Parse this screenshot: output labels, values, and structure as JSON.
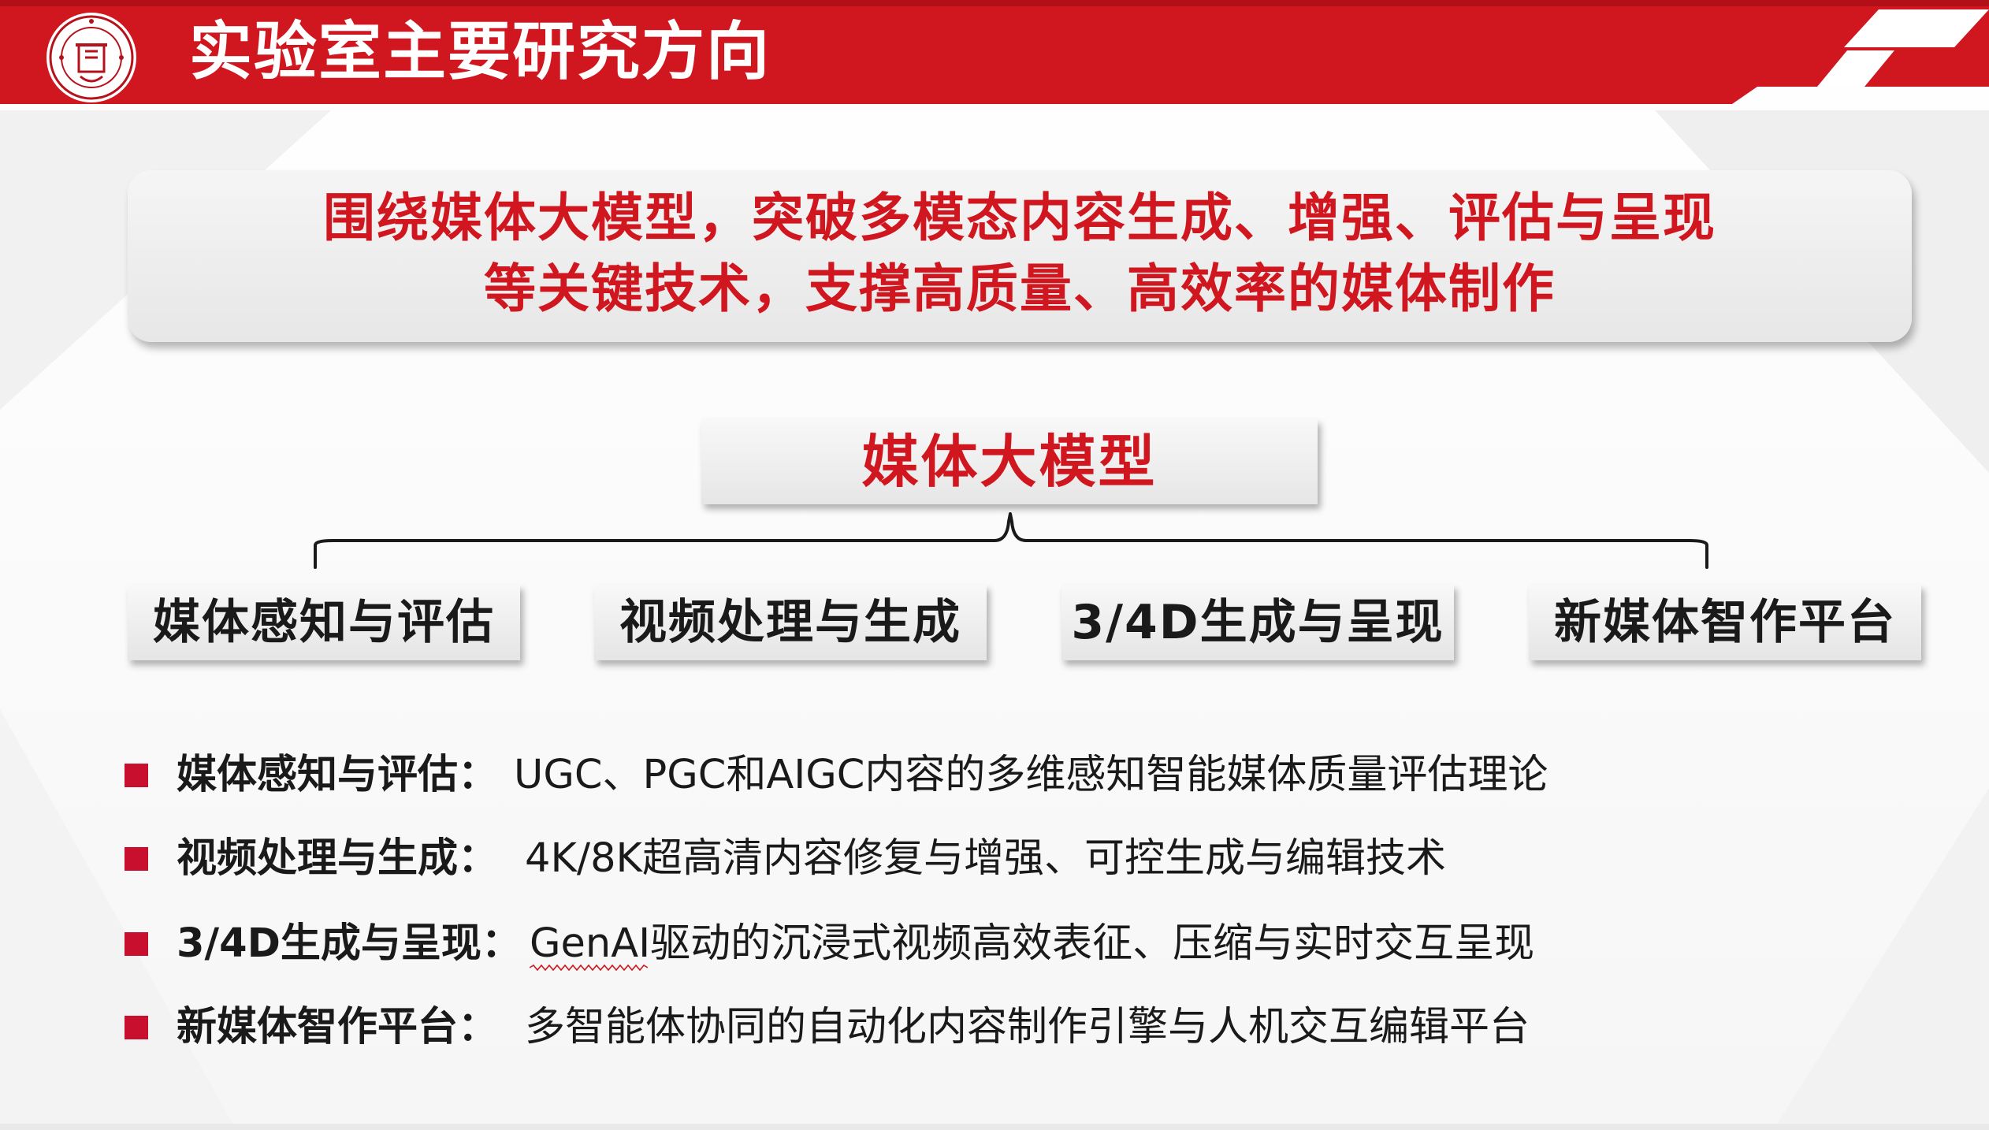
{
  "header": {
    "title": "实验室主要研究方向",
    "logo_icon": "university-seal-icon",
    "bar_color": "#d0161f",
    "corner_icon": "checkered-flag-icon"
  },
  "summary": {
    "line1": "围绕媒体大模型，突破多模态内容生成、增强、评估与呈现",
    "line2": "等关键技术，支撑高质量、高效率的媒体制作",
    "text_color": "#d0161f"
  },
  "hub": {
    "label": "媒体大模型"
  },
  "categories": [
    {
      "label": "媒体感知与评估"
    },
    {
      "label": "视频处理与生成"
    },
    {
      "label": "3/4D生成与呈现"
    },
    {
      "label": "新媒体智作平台"
    }
  ],
  "bullets": [
    {
      "term": "媒体感知与评估：",
      "desc": "UGC、PGC和AIGC内容的多维感知智能媒体质量评估理论"
    },
    {
      "term": "视频处理与生成：",
      "desc": "4K/8K超高清内容修复与增强、可控生成与编辑技术"
    },
    {
      "term": "3/4D生成与呈现：",
      "desc": "GenAI驱动的沉浸式视频高效表征、压缩与实时交互呈现"
    },
    {
      "term": "新媒体智作平台：",
      "desc": "多智能体协同的自动化内容制作引擎与人机交互编辑平台"
    }
  ],
  "bullet_color": "#c8102e"
}
